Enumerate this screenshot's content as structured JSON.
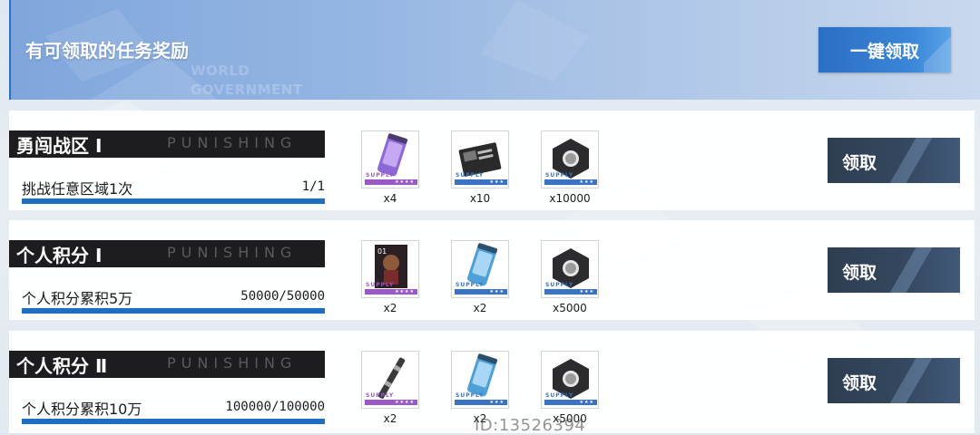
{
  "header": {
    "title": "有可领取的任务奖励",
    "watermark_line1": "WORLD",
    "watermark_line2": "GOVERNMENT",
    "claim_all_label": "一键领取"
  },
  "brand_text": "PUNISHING",
  "claim_label": "领取",
  "tasks": [
    {
      "title": "勇闯战区 Ⅰ",
      "description": "挑战任意区域1次",
      "progress_text": "1/1",
      "progress": 1.0,
      "rewards": [
        {
          "icon": "purple-supply-canister-icon",
          "rarity": "purple",
          "stars": "★★★★",
          "supply": "SUPPLY",
          "qty": "x4"
        },
        {
          "icon": "black-data-card-icon",
          "rarity": "blue",
          "stars": "★★★",
          "supply": "SUPPLY",
          "qty": "x10"
        },
        {
          "icon": "hex-nut-icon",
          "rarity": "blue",
          "stars": "★★★",
          "supply": "SUPPLY",
          "qty": "x10000"
        }
      ]
    },
    {
      "title": "个人积分 Ⅰ",
      "description": "个人积分累积5万",
      "progress_text": "50000/50000",
      "progress": 1.0,
      "rewards": [
        {
          "icon": "character-poster-icon",
          "rarity": "purple",
          "stars": "★★★★",
          "supply": "SUPPLY",
          "qty": "x2"
        },
        {
          "icon": "blue-supply-canister-icon",
          "rarity": "blue",
          "stars": "★★★",
          "supply": "SUPPLY",
          "qty": "x2"
        },
        {
          "icon": "hex-nut-icon",
          "rarity": "blue",
          "stars": "★★★",
          "supply": "SUPPLY",
          "qty": "x5000"
        }
      ]
    },
    {
      "title": "个人积分 Ⅱ",
      "description": "个人积分累积10万",
      "progress_text": "100000/100000",
      "progress": 1.0,
      "rewards": [
        {
          "icon": "pen-module-icon",
          "rarity": "purple",
          "stars": "★★★★",
          "supply": "SUPPLY",
          "qty": "x2"
        },
        {
          "icon": "blue-supply-canister-icon",
          "rarity": "blue",
          "stars": "★★★",
          "supply": "SUPPLY",
          "qty": "x2"
        },
        {
          "icon": "hex-nut-icon",
          "rarity": "blue",
          "stars": "★★★",
          "supply": "SUPPLY",
          "qty": "x5000"
        }
      ]
    }
  ],
  "id_watermark": "ID:13526394"
}
